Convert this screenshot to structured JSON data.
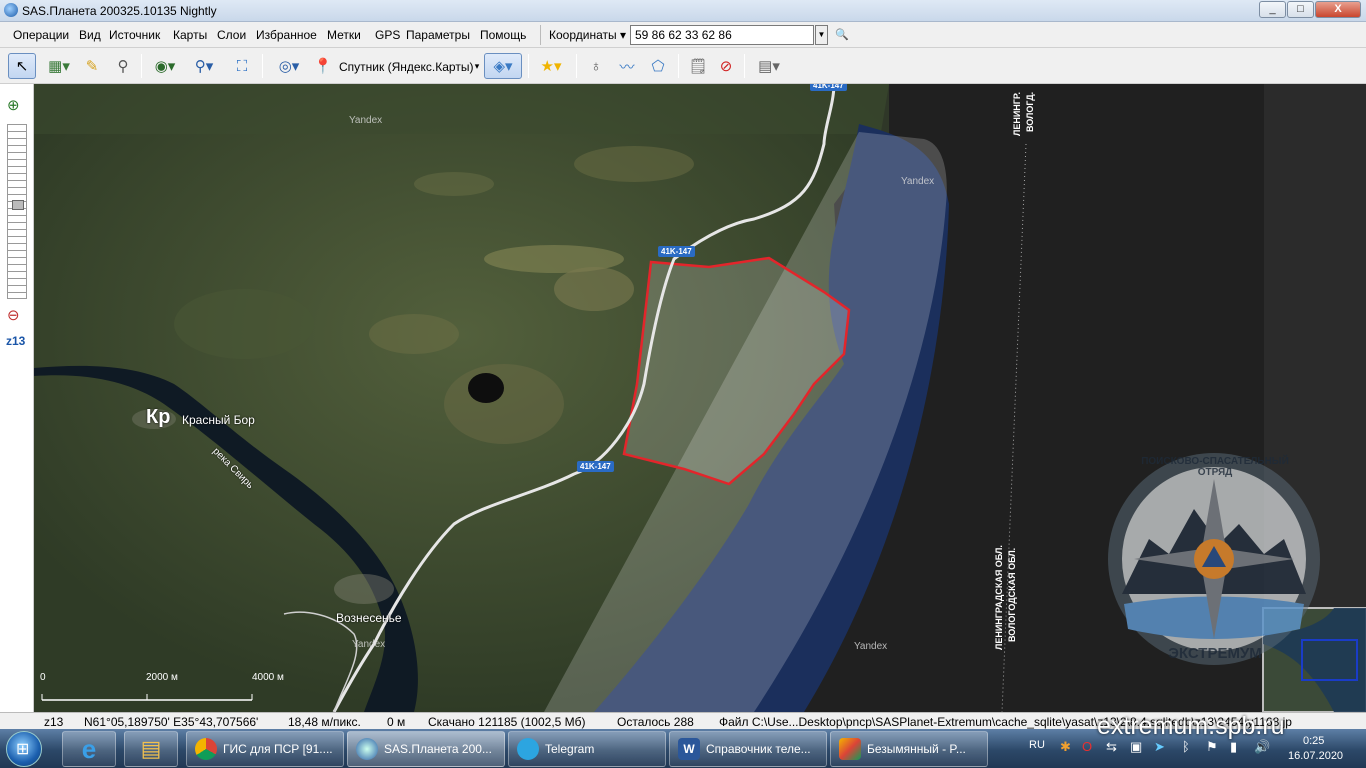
{
  "window": {
    "title": "SAS.Планета 200325.10135 Nightly",
    "btn_min": "_",
    "btn_max": "□",
    "btn_close": "X"
  },
  "menu": [
    "Операции",
    "Вид",
    "Источник",
    "Карты",
    "Слои",
    "Избранное",
    "Метки",
    "GPS",
    "Параметры",
    "Помощь"
  ],
  "coords": {
    "label": "Координаты",
    "value": "59 86 62 33 62 86"
  },
  "toolbar": {
    "map_source": "Спутник (Яндекс.Карты)"
  },
  "zoom": {
    "level": "z13"
  },
  "map": {
    "roads": [
      "41K-147",
      "41K-147"
    ],
    "places": {
      "town_prefix": "Кр",
      "town": "Красный Бор",
      "river": "река Свирь",
      "village": "Вознесенье"
    },
    "watermarks": [
      "Yandex",
      "Yandex",
      "Yandex",
      "Yandex"
    ],
    "region1": {
      "a": "ЛЕНИНГР.",
      "b": "ВОЛОГД."
    },
    "region2": {
      "a": "ЛЕНИНГРАДСКАЯ ОБЛ.",
      "b": "ВОЛОГОДСКАЯ ОБЛ."
    },
    "scale": [
      "0",
      "2000 м",
      "4000 м"
    ],
    "logo": {
      "top": "ПОИСКОВО-СПАСАТЕЛЬНЫЙ ОТРЯД",
      "bottom": "ЭКСТРЕМУМ"
    }
  },
  "status": {
    "zoom": "z13",
    "coords": "N61°05,189750' E35°43,707566'",
    "resolution": "18,48 м/пикс.",
    "distance": "0 м",
    "downloaded": "Скачано 121185 (1002,5 Мб)",
    "remaining": "Осталось 288",
    "file": "Файл C:\\Use...Desktop\\pnср\\SASPlanet-Extremum\\cache_sqlite\\yasat\\z13\\2\\8.4.sqlitedb\\z13\\2454\\y1168.jp"
  },
  "taskbar": {
    "tasks": [
      "ГИС для ПСР [91....",
      "SAS.Планета 200...",
      "Telegram",
      "Справочник теле...",
      "Безымянный - P..."
    ],
    "lang": "RU",
    "time": "0:25",
    "date": "16.07.2020"
  },
  "watermark": "extremum.spb.ru",
  "colors": {
    "polygon": "#e3252b",
    "road_label": "#2a6bc4",
    "sea": "#1b2f5c"
  }
}
